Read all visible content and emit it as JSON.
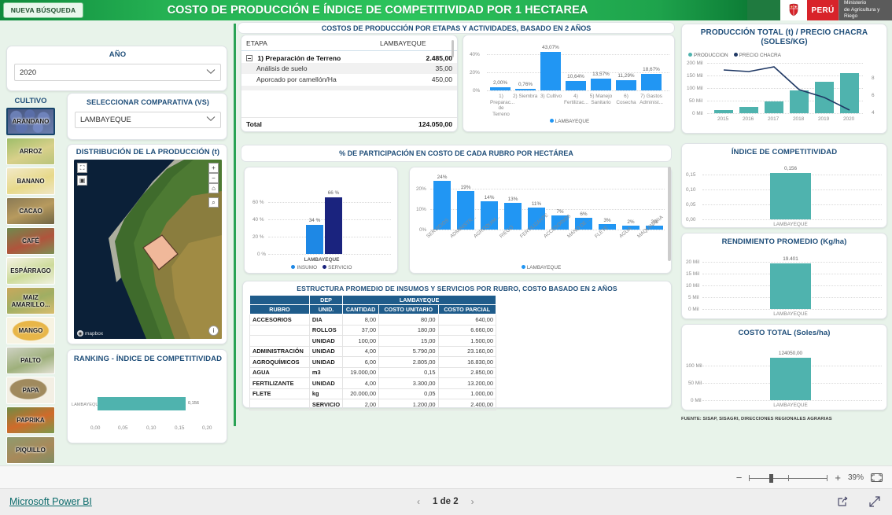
{
  "header": {
    "new_search_button": "NUEVA BÚSQUEDA",
    "title": "COSTO DE PRODUCCIÓN E ÍNDICE DE COMPETITIVIDAD POR 1 HECTAREA",
    "gov": {
      "country": "PERÚ",
      "ministry_line1": "Ministerio",
      "ministry_line2": "de Agricultura y Riego"
    },
    "colors": {
      "green": "#25b153",
      "red": "#d8232a",
      "gray": "#5b5b5b"
    }
  },
  "filters": {
    "year_label": "AÑO",
    "year_value": "2020",
    "crop_label": "CULTIVO",
    "crops": [
      {
        "label": "ARANDANO",
        "selected": true
      },
      {
        "label": "ARROZ",
        "selected": false
      },
      {
        "label": "BANANO",
        "selected": false
      },
      {
        "label": "CACAO",
        "selected": false
      },
      {
        "label": "CAFÉ",
        "selected": false
      },
      {
        "label": "ESPÁRRAGO",
        "selected": false
      },
      {
        "label": "MAIZ AMARILLO...",
        "selected": false
      },
      {
        "label": "MANGO",
        "selected": false
      },
      {
        "label": "PALTO",
        "selected": false
      },
      {
        "label": "PAPA",
        "selected": false
      },
      {
        "label": "PAPRIKA",
        "selected": false
      },
      {
        "label": "PIQUILLO",
        "selected": false
      }
    ],
    "vs_label": "SELECCIONAR COMPARATIVA (VS)",
    "vs_value": "LAMBAYEQUE"
  },
  "map": {
    "title": "DISTRIBUCIÓN DE LA PRODUCCIÓN (t)",
    "attribution": "mapbox"
  },
  "sections": {
    "costs_header": "COSTOS DE PRODUCCIÓN POR ETAPAS Y ACTIVIDADES, BASADO EN 2 AÑOS",
    "participation_header": "% DE PARTICIPACIÓN EN COSTO  DE CADA RUBRO POR HECTÁREA",
    "source_note": "FUENTE: SISAP, SISAGRI, DIRECCIONES REGIONALES AGRARIAS"
  },
  "matrix": {
    "col_etapa": "ETAPA",
    "col_region": "LAMBAYEQUE",
    "rows": [
      {
        "label": "1) Preparación de Terreno",
        "value": "2.485,00",
        "level": 0
      },
      {
        "label": "Análisis de suelo",
        "value": "35,00",
        "level": 1
      },
      {
        "label": "Aporcado por camellón/Ha",
        "value": "450,00",
        "level": 1
      }
    ],
    "total_label": "Total",
    "total_value": "124.050,00"
  },
  "chart_data": [
    {
      "id": "costos-por-etapa",
      "type": "bar",
      "title": "",
      "categories": [
        "1) Preparac... de Terreno",
        "2) Siembra",
        "3) Cultivo",
        "4) Fertilizac...",
        "5) Manejo Sanitario",
        "6) Cosecha",
        "7) Gastos Administ..."
      ],
      "values": [
        2.0,
        0.76,
        43.07,
        10.64,
        13.57,
        11.29,
        18.67
      ],
      "data_labels": [
        "2,00%",
        "0,76%",
        "43,07%",
        "10,64%",
        "13,57%",
        "11,29%",
        "18,67%"
      ],
      "ylabel": "",
      "xlabel": "",
      "yticks": [
        "0%",
        "20%",
        "40%"
      ],
      "ylim": [
        0,
        50
      ],
      "legend": [
        "LAMBAYEQUE"
      ],
      "legend_position": "bottom",
      "color": "#2196f3",
      "grid": true
    },
    {
      "id": "produccion-precio-chacra",
      "type": "bar-line",
      "title": "PRODUCCIÓN TOTAL (t) / PRECIO CHACRA (SOLES/KG)",
      "categories": [
        "2015",
        "2016",
        "2017",
        "2018",
        "2019",
        "2020"
      ],
      "series": [
        {
          "name": "PRODUCCION",
          "type": "bar",
          "color": "#4fb3ae",
          "values": [
            10000,
            24000,
            47000,
            92000,
            127000,
            162000
          ]
        },
        {
          "name": "PRECIO CHACRA",
          "type": "line",
          "color": "#1f3864",
          "values": [
            8.2,
            8.1,
            8.5,
            6.0,
            5.4,
            4.3
          ]
        }
      ],
      "yticks_left": [
        "0 Mil",
        "50 Mil",
        "100 Mil",
        "150 Mil",
        "200 Mil"
      ],
      "yticks_right": [
        "4",
        "6",
        "8"
      ],
      "ylim_left": [
        0,
        200000
      ],
      "ylim_right": [
        4,
        9
      ],
      "legend": [
        "PRODUCCION",
        "PRECIO CHACRA"
      ],
      "legend_position": "top",
      "grid": true
    },
    {
      "id": "insumo-servicio",
      "type": "bar",
      "title": "",
      "categories": [
        "LAMBAYEQUE"
      ],
      "series": [
        {
          "name": "INSUMO",
          "color": "#1e88e5",
          "values": [
            34
          ]
        },
        {
          "name": "SERVICIO",
          "color": "#1a237e",
          "values": [
            66
          ]
        }
      ],
      "data_labels": [
        "34 %",
        "66 %"
      ],
      "yticks": [
        "0 %",
        "20 %",
        "40 %",
        "60 %"
      ],
      "ylim": [
        0,
        72
      ],
      "legend": [
        "INSUMO",
        "SERVICIO"
      ],
      "legend_position": "bottom",
      "grid": true
    },
    {
      "id": "participacion-rubro",
      "type": "bar",
      "title": "",
      "categories": [
        "SERVICIOS",
        "ADMINISTR...",
        "AGROQUIM...",
        "RIEGO",
        "FERTILIZANTE",
        "ACCESORIOS",
        "MANO DE ...",
        "FLETE",
        "AGUA",
        "MAQUINARIA"
      ],
      "values": [
        24,
        19,
        14,
        13,
        11,
        7,
        6,
        3,
        2,
        2
      ],
      "data_labels": [
        "24%",
        "19%",
        "14%",
        "13%",
        "11%",
        "7%",
        "6%",
        "3%",
        "2%",
        "2%"
      ],
      "yticks": [
        "0%",
        "10%",
        "20%"
      ],
      "ylim": [
        0,
        27
      ],
      "legend": [
        "LAMBAYEQUE"
      ],
      "legend_position": "bottom",
      "color": "#2196f3",
      "grid": true
    },
    {
      "id": "indice-competitividad",
      "type": "bar",
      "title": "ÍNDICE DE COMPETITIVIDAD",
      "categories": [
        "LAMBAYEQUE"
      ],
      "values": [
        0.156
      ],
      "data_labels": [
        "0,156"
      ],
      "yticks": [
        "0,00",
        "0,05",
        "0,10",
        "0,15"
      ],
      "ylim": [
        0,
        0.168
      ],
      "color": "#4fb3ae",
      "grid": true
    },
    {
      "id": "rendimiento-promedio",
      "type": "bar",
      "title": "RENDIMIENTO PROMEDIO (Kg/ha)",
      "categories": [
        "LAMBAYEQUE"
      ],
      "values": [
        19401
      ],
      "data_labels": [
        "19.401"
      ],
      "yticks": [
        "0 Mil",
        "5 Mil",
        "10 Mil",
        "15 Mil",
        "20 Mil"
      ],
      "ylim": [
        0,
        21500
      ],
      "color": "#4fb3ae",
      "grid": true
    },
    {
      "id": "costo-total",
      "type": "bar",
      "title": "COSTO TOTAL (Soles/ha)",
      "categories": [
        "LAMBAYEQUE"
      ],
      "values": [
        124050
      ],
      "data_labels": [
        "124050,00"
      ],
      "yticks": [
        "0 Mil",
        "50 Mil",
        "100 Mil"
      ],
      "ylim": [
        0,
        138000
      ],
      "color": "#4fb3ae",
      "grid": true
    },
    {
      "id": "ranking-indice-competitividad",
      "type": "bar",
      "orientation": "horizontal",
      "title": "RANKING - ÍNDICE DE COMPETITIVIDAD",
      "categories": [
        "LAMBAYEQUE"
      ],
      "values": [
        0.156
      ],
      "data_labels": [
        "0,156"
      ],
      "xticks": [
        "0,00",
        "0,05",
        "0,10",
        "0,15",
        "0,20"
      ],
      "xlim": [
        0,
        0.2
      ],
      "color": "#4fb3ae",
      "grid": true
    }
  ],
  "table": {
    "title": "ESTRUCTURA PROMEDIO DE INSUMOS Y SERVICIOS POR RUBRO, COSTO BASADO EN 2 AÑOS",
    "group_headers": [
      "",
      "DEP",
      "LAMBAYEQUE"
    ],
    "columns": [
      "RUBRO",
      "UNID.",
      "CANTIDAD",
      "COSTO UNITARIO",
      "COSTO PARCIAL"
    ],
    "rows": [
      [
        "ACCESORIOS",
        "DIA",
        "8,00",
        "80,00",
        "640,00"
      ],
      [
        "",
        "ROLLOS",
        "37,00",
        "180,00",
        "6.660,00"
      ],
      [
        "",
        "UNIDAD",
        "100,00",
        "15,00",
        "1.500,00"
      ],
      [
        "ADMINISTRACIÓN",
        "UNIDAD",
        "4,00",
        "5.790,00",
        "23.160,00"
      ],
      [
        "AGROQUÍMICOS",
        "UNIDAD",
        "6,00",
        "2.805,00",
        "16.830,00"
      ],
      [
        "AGUA",
        "m3",
        "19.000,00",
        "0,15",
        "2.850,00"
      ],
      [
        "FERTILIZANTE",
        "UNIDAD",
        "4,00",
        "3.300,00",
        "13.200,00"
      ],
      [
        "FLETE",
        "kg",
        "20.000,00",
        "0,05",
        "1.000,00"
      ],
      [
        "",
        "SERVICIO",
        "2,00",
        "1.200,00",
        "2.400,00"
      ]
    ]
  },
  "footer": {
    "zoom_value": "39%",
    "power_bi_link": "Microsoft Power BI",
    "page_indicator": "1 de 2"
  }
}
